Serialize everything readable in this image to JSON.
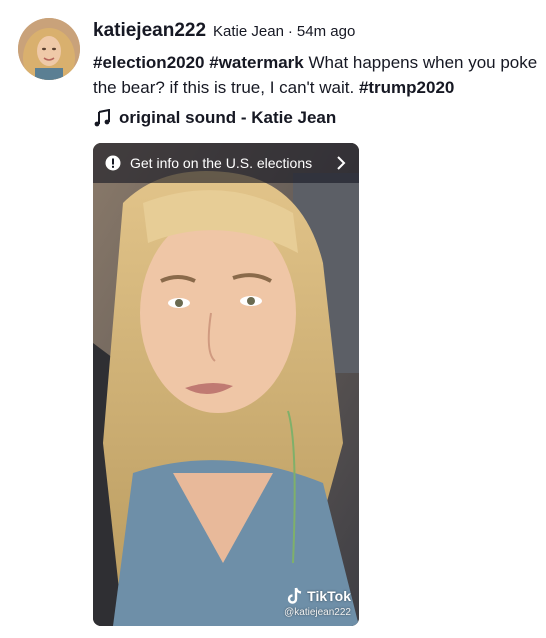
{
  "post": {
    "username": "katiejean222",
    "nickname": "Katie Jean",
    "separator": "·",
    "time": "54m ago",
    "caption": {
      "tag1": "#election2020",
      "tag2": "#watermark",
      "text": " What happens when you poke the bear? if this is true, I can't wait. ",
      "tag3": "#trump2020"
    },
    "sound": "original sound - Katie Jean",
    "icons": {
      "avatar": "avatar-photo",
      "sound": "music-note-icon"
    }
  },
  "video": {
    "banner": {
      "text": "Get info on the U.S. elections",
      "icon": "info-icon",
      "chevron": "chevron-right-icon"
    },
    "watermark": {
      "brand": "TikTok",
      "handle": "@katiejean222",
      "icon": "tiktok-logo-icon"
    }
  }
}
